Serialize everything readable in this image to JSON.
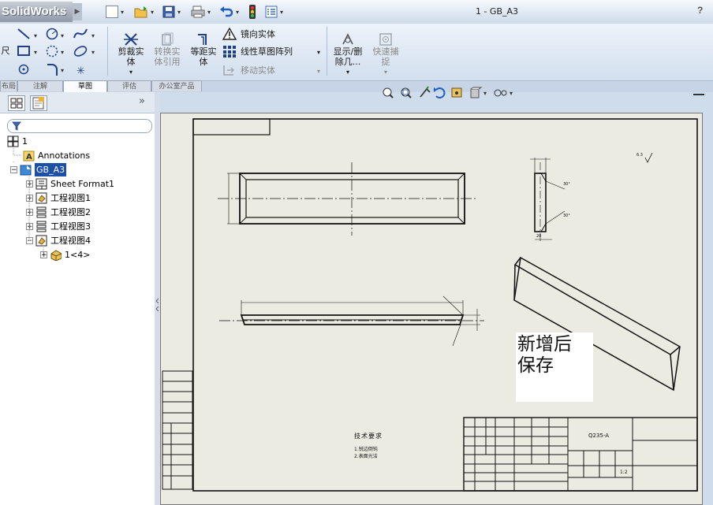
{
  "app": {
    "logo_text": "SolidWorks",
    "document_title": "1 - GB_A3",
    "help_label": "?"
  },
  "ribbon": {
    "trim_label_1": "剪裁实",
    "trim_label_2": "体",
    "convert_label_1": "转换实",
    "convert_label_2": "体引用",
    "offset_label_1": "等距实",
    "offset_label_2": "体",
    "mirror_label": "镜向实体",
    "linear_pattern_label": "线性草图阵列",
    "move_label": "移动实体",
    "display_delete_label_1": "显示/删",
    "display_delete_label_2": "除几...",
    "quick_snap_label_1": "快速捕",
    "quick_snap_label_2": "捉",
    "partial_left_label": "尺"
  },
  "tabs": [
    {
      "label": "布局"
    },
    {
      "label": "注解"
    },
    {
      "label": "草图"
    },
    {
      "label": "评估"
    },
    {
      "label": "办公室产品"
    }
  ],
  "tree": {
    "root": "1",
    "annotations": "Annotations",
    "sheet": "GB_A3",
    "sheet_format": "Sheet Format1",
    "views": [
      "工程视图1",
      "工程视图2",
      "工程视图3",
      "工程视图4"
    ],
    "part": "1<4>",
    "collapse_panel_label": "»"
  },
  "drawing": {
    "sticker_line1": "新增后",
    "sticker_line2": "保存",
    "material": "Q235-A",
    "tech_req_title": "技术要求",
    "tech_req_1": "1.锐边倒钝",
    "tech_req_2": "2.表面光洁",
    "scale": "1:2",
    "roughness": "6.3"
  }
}
